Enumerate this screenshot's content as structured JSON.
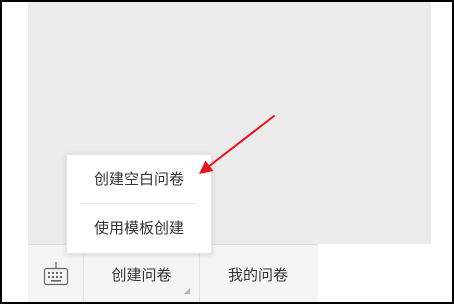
{
  "menu": {
    "keyboard_icon": "keyboard-icon",
    "create_label": "创建问卷",
    "mine_label": "我的问卷"
  },
  "popup": {
    "items": [
      {
        "label": "创建空白问卷"
      },
      {
        "label": "使用模板创建"
      }
    ]
  },
  "annotation": {
    "arrow_color": "#e8141b"
  }
}
